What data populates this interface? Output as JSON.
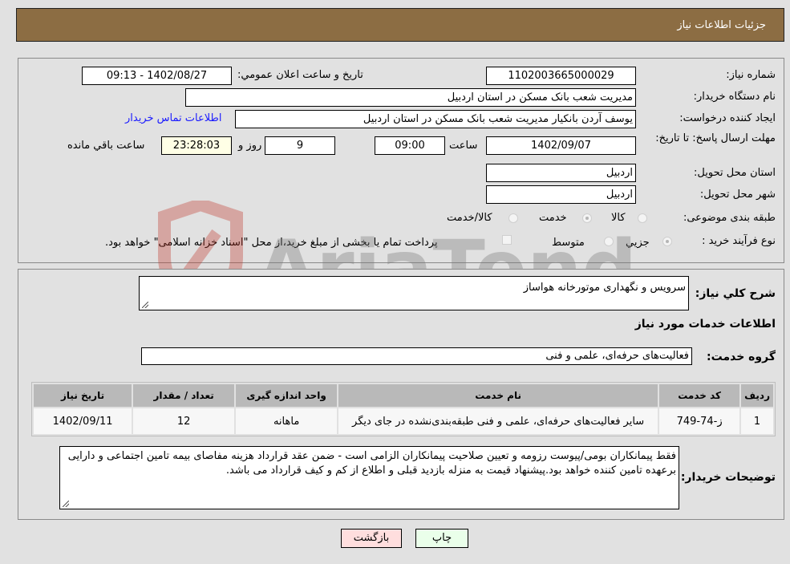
{
  "header": {
    "title": "جزئیات اطلاعات نیاز"
  },
  "form": {
    "need_number_label": "شماره نیاز:",
    "need_number": "1102003665000029",
    "announce_label": "تاریخ و ساعت اعلان عمومي:",
    "announce_value": "1402/08/27 - 09:13",
    "buyer_org_label": "نام دستگاه خريدار:",
    "buyer_org": "مديريت شعب بانک مسکن در استان اردبيل",
    "requester_label": "ايجاد کننده درخواست:",
    "requester": "يوسف  آردن بانکيار مديريت شعب بانک مسکن در استان اردبيل",
    "contact_link": "اطلاعات تماس خريدار",
    "deadline_label": "مهلت ارسال پاسخ: تا تاريخ:",
    "deadline_date": "1402/09/07",
    "time_label": "ساعت",
    "deadline_time": "09:00",
    "days_value": "9",
    "days_label": "روز و",
    "remaining_time": "23:28:03",
    "remaining_label": "ساعت باقي مانده",
    "province_label": "استان محل تحويل:",
    "province": "اردبيل",
    "city_label": "شهر محل تحويل:",
    "city": "اردبيل",
    "category_label": "طبقه بندی موضوعی:",
    "category_options": [
      {
        "label": "کالا",
        "selected": false
      },
      {
        "label": "خدمت",
        "selected": true
      },
      {
        "label": "کالا/خدمت",
        "selected": false
      }
    ],
    "process_label": "نوع فرآيند خريد :",
    "process_options": [
      {
        "label": "جزيي",
        "selected": true
      },
      {
        "label": "متوسط",
        "selected": false
      }
    ],
    "treasury_checkbox_label": "پرداخت تمام یا بخشی از مبلغ خرید،از محل \"اسناد خزانه اسلامی\" خواهد بود.",
    "treasury_checked": false
  },
  "details": {
    "summary_label": "شرح کلي نياز:",
    "summary": "سرويس و نگهداری موتورخانه هواساز",
    "services_title": "اطلاعات خدمات مورد نياز",
    "service_group_label": "گروه خدمت:",
    "service_group": "فعاليت‌های حرفه‌ای، علمی و فنی",
    "table": {
      "headers": [
        "رديف",
        "کد خدمت",
        "نام خدمت",
        "واحد اندازه گيری",
        "تعداد / مقدار",
        "تاريخ نياز"
      ],
      "rows": [
        [
          "1",
          "ز-74-749",
          "ساير فعاليت‌های حرفه‌ای، علمی و فنی طبقه‌بندی‌نشده در جای ديگر",
          "ماهانه",
          "12",
          "1402/09/11"
        ]
      ]
    },
    "buyer_notes_label": "توضيحات خريدار:",
    "buyer_notes": "فقط پيمانکاران بومی/پيوست رزومه و تعيين صلاحيت پيمانکاران الزامی است - ضمن عقد قرارداد هزينه مفاصای بيمه تامين اجتماعی و دارايی برعهده تامين کننده خواهد بود.پيشنهاد قيمت به منزله بازديد قبلی و اطلاع از کم و کيف قرارداد می باشد."
  },
  "buttons": {
    "print": "چاپ",
    "back": "بازگشت"
  },
  "watermark": {
    "text": "AriaTender.neT"
  }
}
